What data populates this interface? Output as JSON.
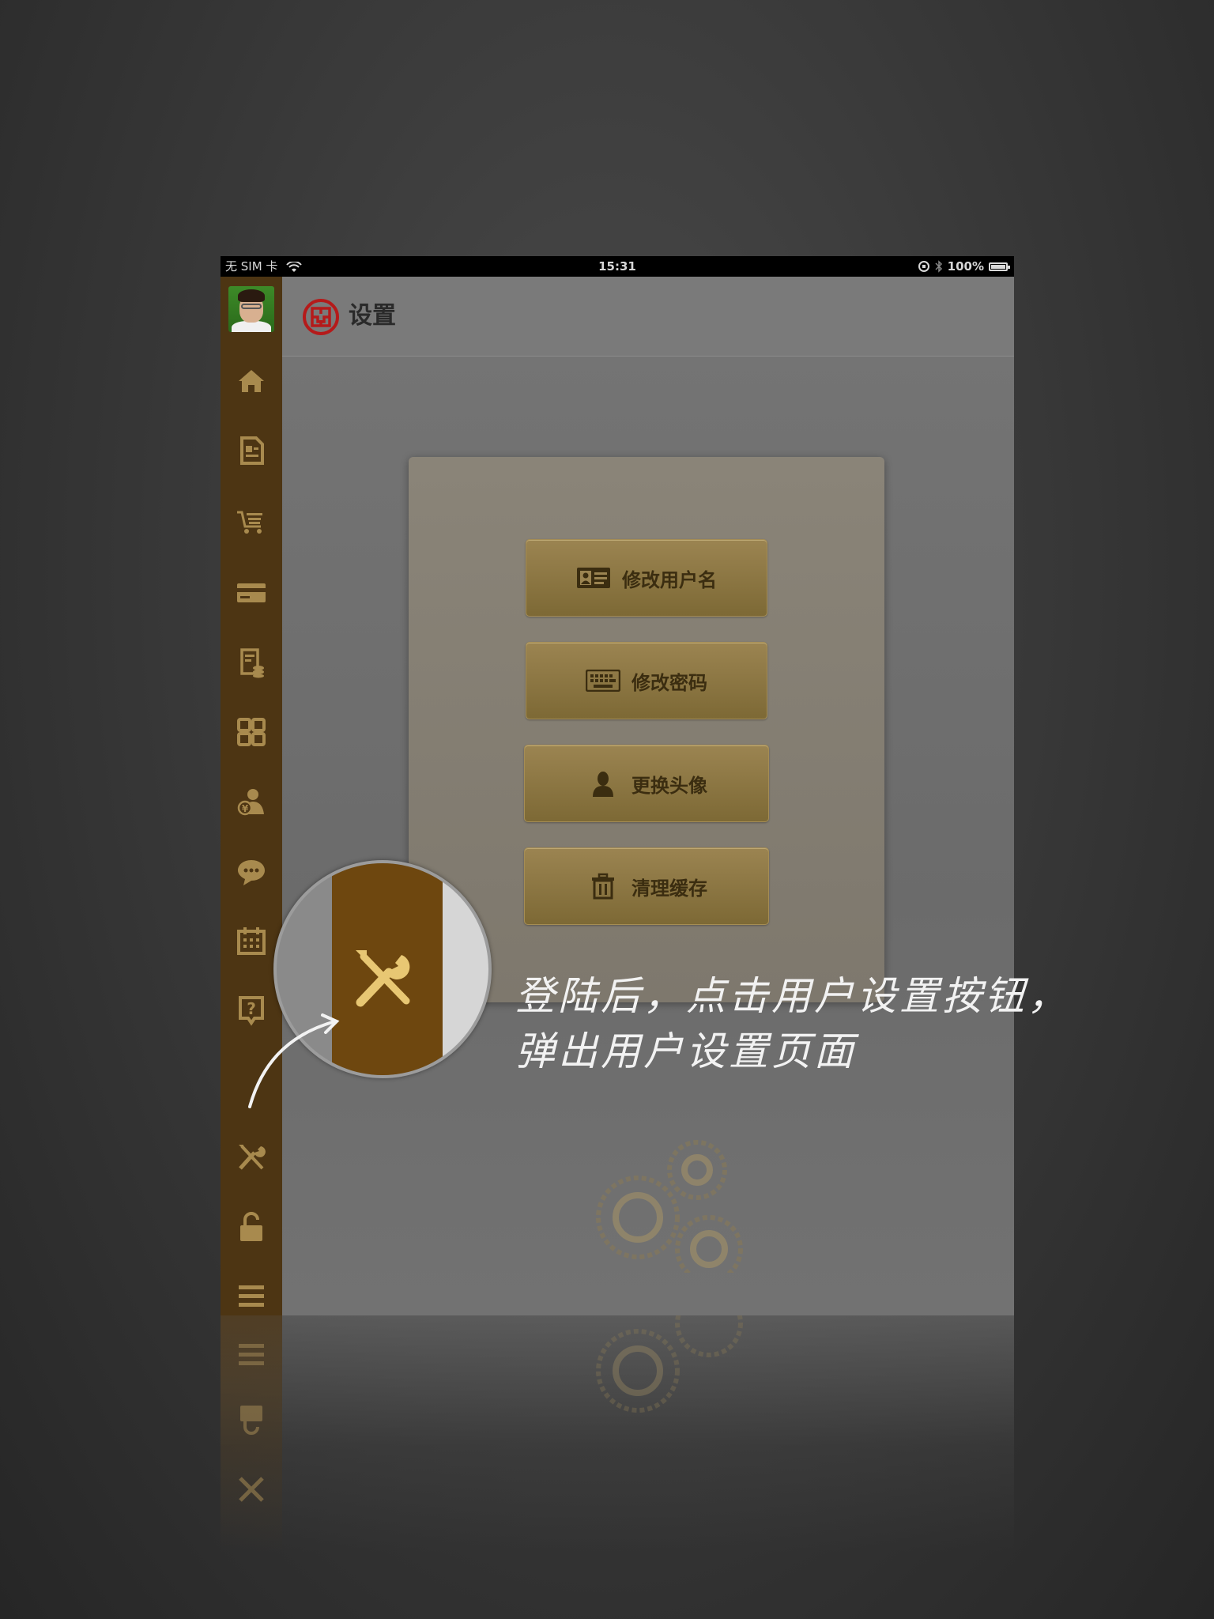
{
  "status_bar": {
    "carrier": "无 SIM 卡",
    "time": "15:31",
    "battery": "100%"
  },
  "sidebar": {
    "avatar": "avatar-image",
    "items": [
      {
        "icon": "home-icon"
      },
      {
        "icon": "document-icon"
      },
      {
        "icon": "cart-icon"
      },
      {
        "icon": "card-icon"
      },
      {
        "icon": "bill-coins-icon"
      },
      {
        "icon": "grid-icon"
      },
      {
        "icon": "user-finance-icon"
      },
      {
        "icon": "chat-icon"
      },
      {
        "icon": "calendar-icon"
      },
      {
        "icon": "help-icon"
      },
      {
        "icon": "settings-tools-icon"
      },
      {
        "icon": "unlock-icon"
      },
      {
        "icon": "menu-icon"
      }
    ]
  },
  "header": {
    "title": "设置"
  },
  "settings_card": {
    "buttons": [
      {
        "label": "修改用户名",
        "icon": "id-card-icon"
      },
      {
        "label": "修改密码",
        "icon": "keyboard-icon"
      },
      {
        "label": "更换头像",
        "icon": "person-icon"
      },
      {
        "label": "清理缓存",
        "icon": "trash-icon"
      }
    ]
  },
  "annotation": {
    "line1": "登陆后，点击用户设置按钮，",
    "line2": "弹出用户设置页面"
  },
  "colors": {
    "sidebar": "#4d3513",
    "icon": "#a88a4e",
    "button": "#8c7642",
    "highlight_bar": "#6e470f",
    "highlight_icon": "#e8c773"
  }
}
